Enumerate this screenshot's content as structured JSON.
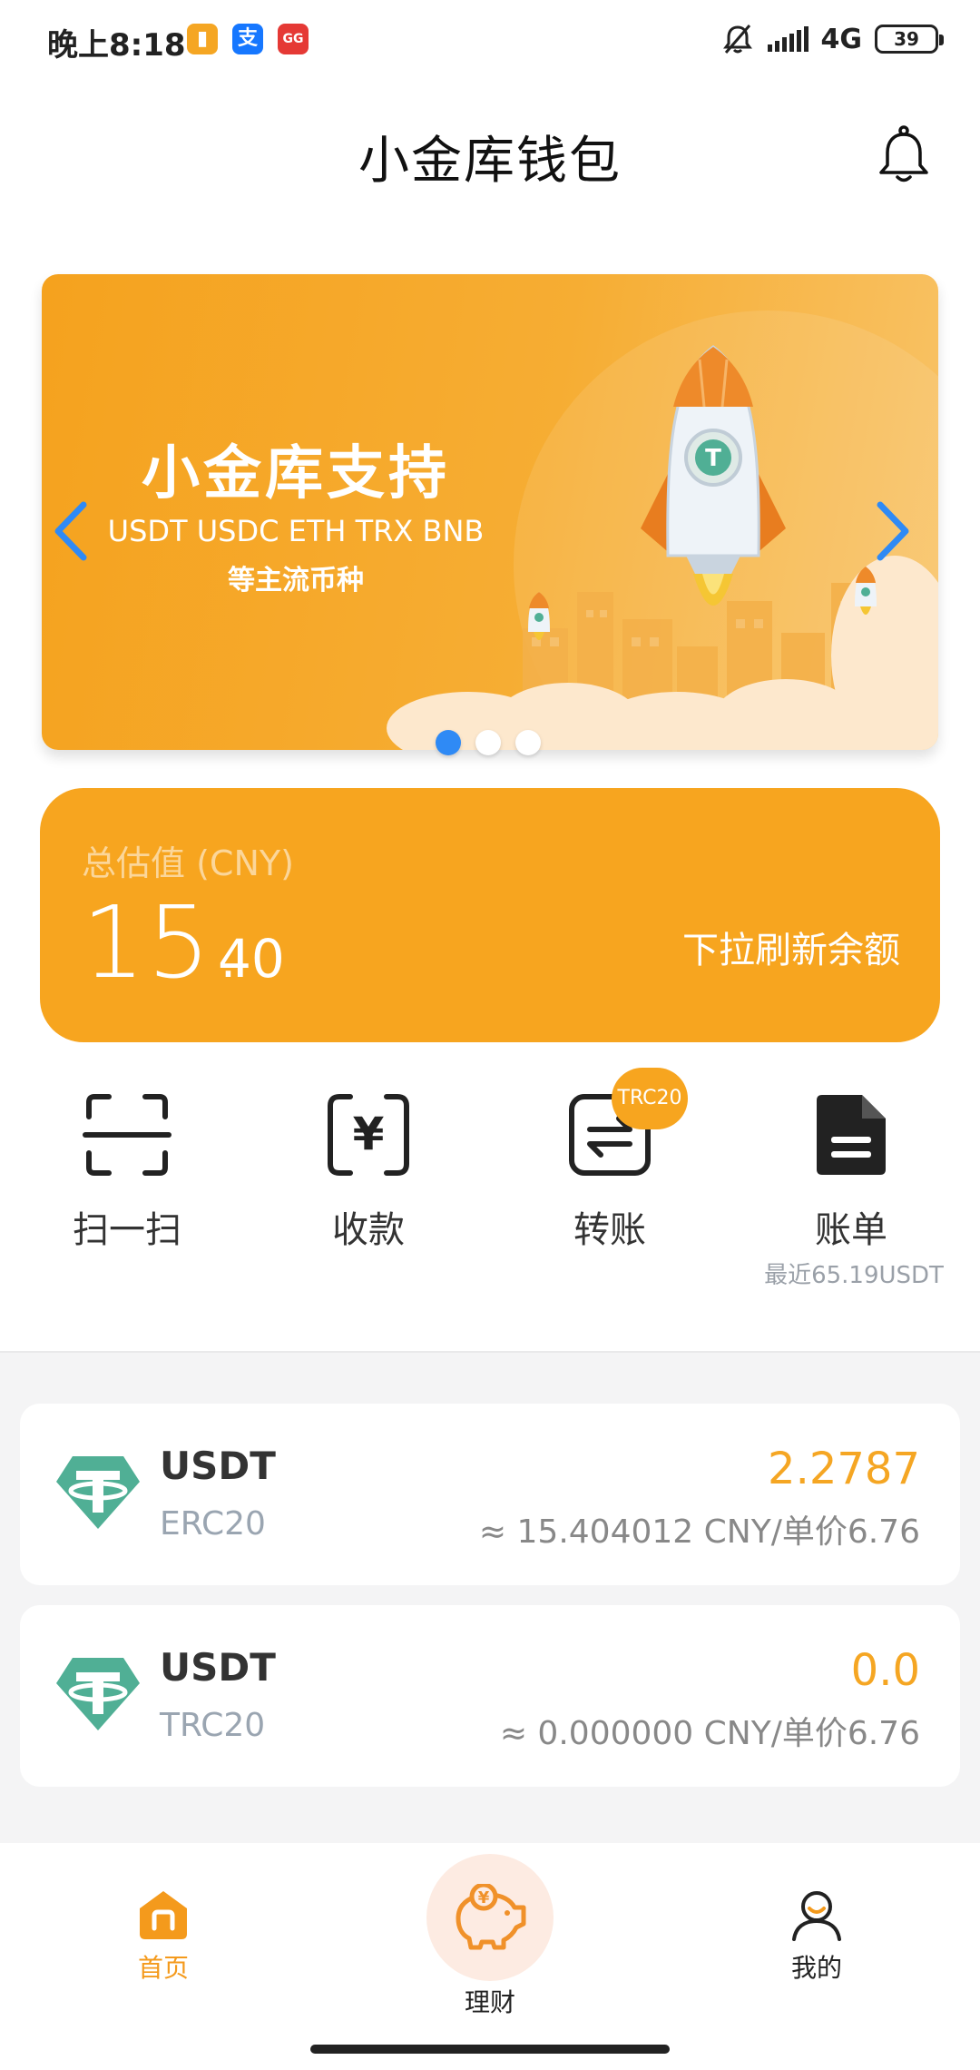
{
  "status_bar": {
    "time": "晚上8:18",
    "apps": [
      {
        "glyph": "▮",
        "color": "#f5a623"
      },
      {
        "glyph": "支",
        "color": "#1677ff"
      },
      {
        "glyph": "GG",
        "color": "#e53935"
      }
    ],
    "network": "4G",
    "battery": "39"
  },
  "header": {
    "title": "小金库钱包",
    "bell_icon": "bell-icon"
  },
  "banner": {
    "title": "小金库支持",
    "coins": "USDT USDC ETH TRX BNB",
    "subtitle": "等主流币种",
    "active_slide": 1,
    "slides": 3
  },
  "balance": {
    "label": "总估值 (CNY)",
    "integer": "15.",
    "decimal": "40",
    "refresh_hint": "下拉刷新余额"
  },
  "actions": [
    {
      "label": "扫一扫",
      "icon": "scan-icon"
    },
    {
      "label": "收款",
      "icon": "receive-icon"
    },
    {
      "label": "转账",
      "icon": "transfer-icon",
      "badge": "TRC20"
    },
    {
      "label": "账单",
      "icon": "bill-icon",
      "subtext": "最近65.19USDT"
    }
  ],
  "assets": [
    {
      "name": "USDT",
      "chain": "ERC20",
      "amount": "2.2787",
      "value": "≈ 15.404012 CNY/单价6.76"
    },
    {
      "name": "USDT",
      "chain": "TRC20",
      "amount": "0.0",
      "value": "≈ 0.000000 CNY/单价6.76"
    }
  ],
  "nav": {
    "home": "首页",
    "finance": "理财",
    "mine": "我的"
  },
  "colors": {
    "accent": "#f7a51f",
    "amount": "#f5a623",
    "tether": "#50af95",
    "dot_active": "#2f8af5"
  }
}
